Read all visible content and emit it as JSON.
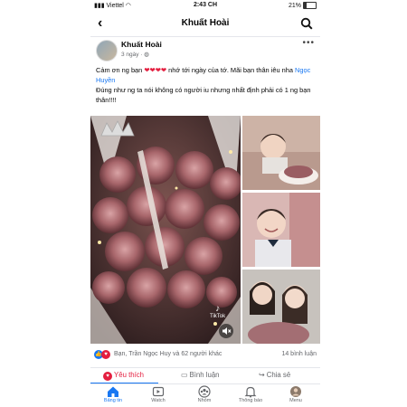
{
  "status_bar": {
    "carrier": "Viettel",
    "time": "2:43 CH",
    "battery": "21%"
  },
  "nav": {
    "title": "Khuất Hoài"
  },
  "post": {
    "author": "Khuất Hoài",
    "meta": "3 ngày · ",
    "caption": {
      "line1": "Cảm ơn ng bạn ",
      "hearts": "❤❤❤❤",
      "line1_rest": " nhớ tới ngày của tớ. Mãi bạn thân iêu nha ",
      "mention": "Ngọc Huyền",
      "line2": "Đúng như ng ta nói không có người iu nhưng nhất định phải có 1 ng bạn thân!!!!"
    },
    "video": {
      "watermark": "TikTok"
    },
    "reactions_text": "Bạn, Trần Ngọc Huy và 62 người khác",
    "comments_text": "14 bình luận"
  },
  "actions": {
    "like": "Yêu thích",
    "comment": "Bình luận",
    "share": "Chia sẻ"
  },
  "tabs": [
    {
      "label": "Bảng tin"
    },
    {
      "label": "Watch"
    },
    {
      "label": "Nhóm"
    },
    {
      "label": "Thông báo"
    },
    {
      "label": "Menu"
    }
  ],
  "colors": {
    "accent": "#1877f2",
    "love": "#e41e3f"
  }
}
